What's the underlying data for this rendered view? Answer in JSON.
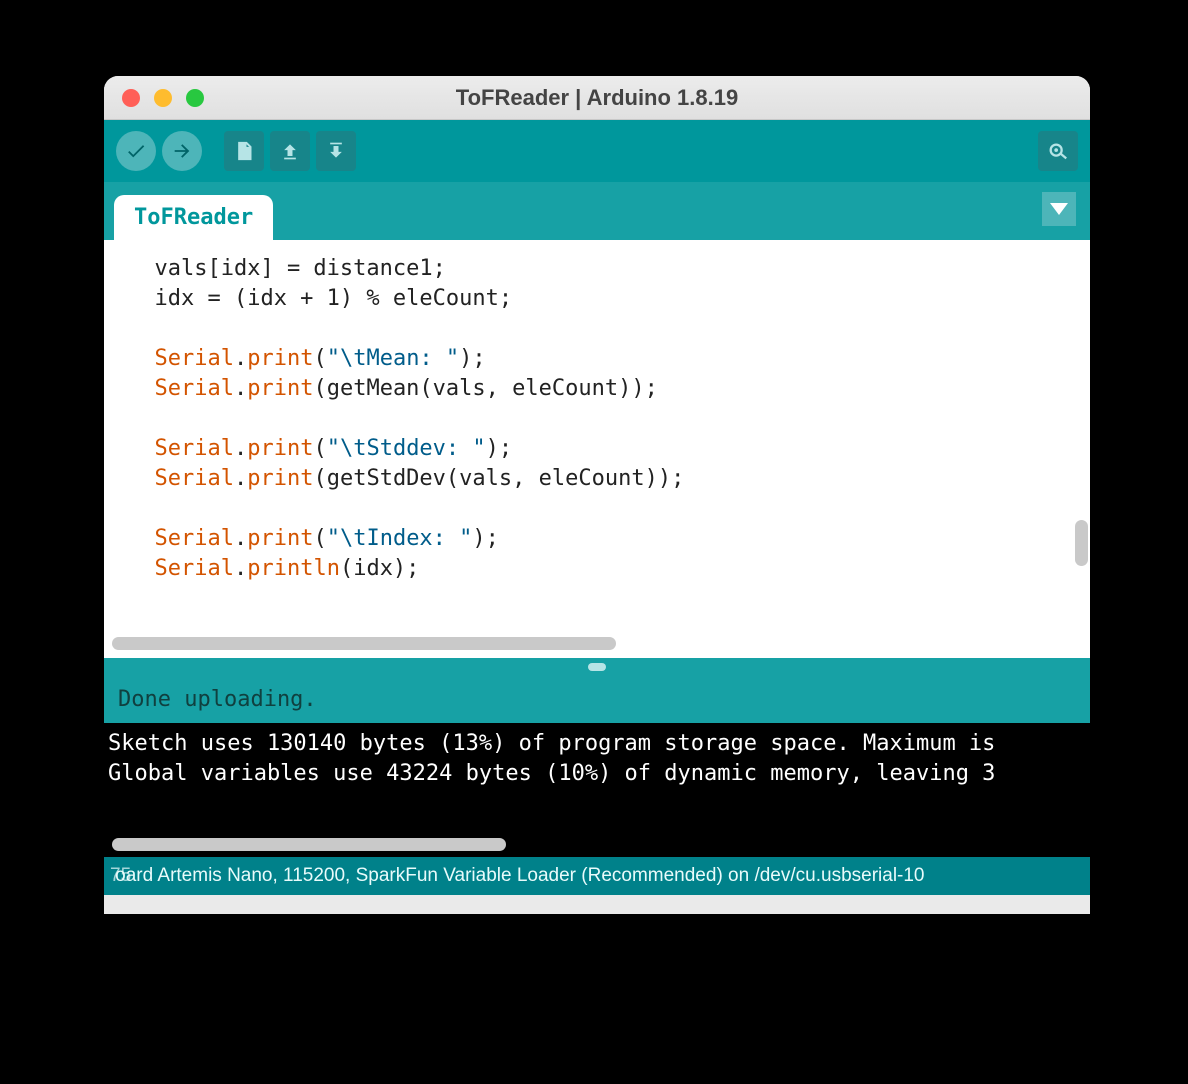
{
  "window": {
    "title": "ToFReader | Arduino 1.8.19"
  },
  "toolbar": {
    "verify": "Verify",
    "upload": "Upload",
    "new": "New",
    "open": "Open",
    "save": "Save",
    "serial": "Serial Monitor"
  },
  "tab": {
    "name": "ToFReader"
  },
  "code": {
    "l1a": "  vals[idx] = distance1;",
    "l2a": "  idx = (idx + 1) % eleCount;",
    "blank": "",
    "serial": "Serial",
    "dot": ".",
    "print": "print",
    "println": "println",
    "strMean": "\"\\tMean: \"",
    "argMean": "(getMean(vals, eleCount));",
    "strStd": "\"\\tStddev: \"",
    "argStd": "(getStdDev(vals, eleCount));",
    "strIdx": "\"\\tIndex: \"",
    "argIdx": "(idx);",
    "open": "(",
    "close": ");"
  },
  "status": {
    "text": "Done uploading."
  },
  "console": {
    "l1": "Sketch uses 130140 bytes (13%) of program storage space. Maximum is",
    "l2": "Global variables use 43224 bytes (10%) of dynamic memory, leaving 3"
  },
  "footer": {
    "left": "75",
    "text": "oard Artemis Nano, 115200, SparkFun Variable Loader (Recommended) on /dev/cu.usbserial-10"
  }
}
